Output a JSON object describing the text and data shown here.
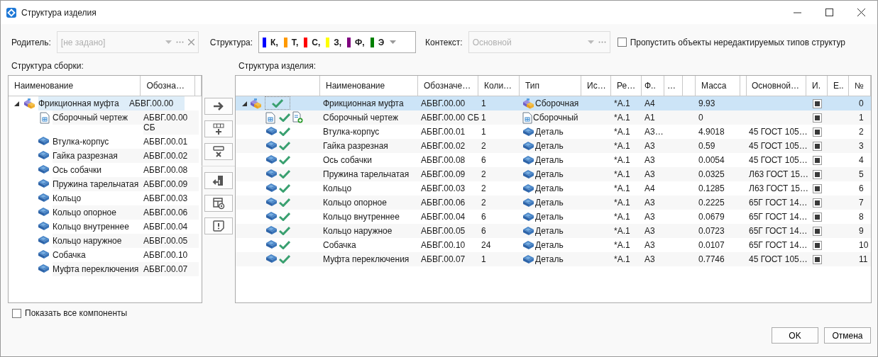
{
  "window": {
    "title": "Структура изделия"
  },
  "parent_field": {
    "label": "Родитель:",
    "placeholder": "[не задано]"
  },
  "structure_field": {
    "label": "Структура:",
    "tags": [
      {
        "text": "К,",
        "color": "#0000ff"
      },
      {
        "text": "Т,",
        "color": "#ff9900"
      },
      {
        "text": "С,",
        "color": "#ff0000"
      },
      {
        "text": "З,",
        "color": "#ffff00"
      },
      {
        "text": "Ф,",
        "color": "#800080"
      },
      {
        "text": "Э",
        "color": "#008000"
      }
    ]
  },
  "context_field": {
    "label": "Контекст:",
    "placeholder": "Основной"
  },
  "skip_checkbox": {
    "label": "Пропустить объекты нередактируемых типов структур",
    "checked": false
  },
  "assembly_tree": {
    "title": "Структура сборки:",
    "columns": [
      "Наименование",
      "Обозна…"
    ],
    "items": [
      {
        "kind": "assembly",
        "name": "Фрикционная муфта",
        "designation": "АБВГ.00.00",
        "selected": true,
        "expanded": true,
        "children": [
          {
            "kind": "drawing",
            "name": "Сборочный чертеж",
            "designation": "АБВГ.00.00 СБ",
            "selected": false
          },
          {
            "kind": "part",
            "name": "Втулка-корпус",
            "designation": "АБВГ.00.01",
            "selected": false
          },
          {
            "kind": "part",
            "name": "Гайка разрезная",
            "designation": "АБВГ.00.02",
            "selected": false
          },
          {
            "kind": "part",
            "name": "Ось собачки",
            "designation": "АБВГ.00.08",
            "selected": false
          },
          {
            "kind": "part",
            "name": "Пружина тарельчатая",
            "designation": "АБВГ.00.09",
            "selected": false
          },
          {
            "kind": "part",
            "name": "Кольцо",
            "designation": "АБВГ.00.03",
            "selected": false
          },
          {
            "kind": "part",
            "name": "Кольцо опорное",
            "designation": "АБВГ.00.06",
            "selected": false
          },
          {
            "kind": "part",
            "name": "Кольцо внутреннее",
            "designation": "АБВГ.00.04",
            "selected": false
          },
          {
            "kind": "part",
            "name": "Кольцо наружное",
            "designation": "АБВГ.00.05",
            "selected": false
          },
          {
            "kind": "part",
            "name": "Собачка",
            "designation": "АБВГ.00.10",
            "selected": false
          },
          {
            "kind": "part",
            "name": "Муфта переключения",
            "designation": "АБВГ.00.07",
            "selected": false
          }
        ]
      }
    ]
  },
  "product_tree": {
    "title": "Структура изделия:",
    "columns": [
      "Наименование",
      "Обозначе…",
      "Коли…",
      "Тип",
      "Ис…",
      "Ре…",
      "Ф..",
      "…",
      "Масса",
      "Основной…",
      "И.",
      "Е..",
      "№"
    ],
    "rows": [
      {
        "kind": "assembly",
        "name": "Фрикционная муфта",
        "designation": "АБВГ.00.00",
        "qty": "1",
        "type": "Сборочная",
        "rev": "*A.1",
        "format": "A4",
        "mass": "9.93",
        "checked": true,
        "number": "0",
        "selected": true,
        "expanded": true,
        "children": [
          {
            "kind": "drawing",
            "name": "Сборочный чертеж",
            "designation": "АБВГ.00.00 СБ",
            "qty": "1",
            "type": "Сборочный",
            "rev": "*A.1",
            "format": "A1",
            "mass": "0",
            "checked": true,
            "number": "1",
            "selected": false
          },
          {
            "kind": "part",
            "name": "Втулка-корпус",
            "designation": "АБВГ.00.01",
            "qty": "1",
            "type": "Деталь",
            "rev": "*A.1",
            "format": "A3…",
            "mass": "4.9018",
            "material": "45 ГОСТ 105…",
            "checked": true,
            "number": "2",
            "selected": false
          },
          {
            "kind": "part",
            "name": "Гайка разрезная",
            "designation": "АБВГ.00.02",
            "qty": "2",
            "type": "Деталь",
            "rev": "*A.1",
            "format": "A3",
            "mass": "0.59",
            "material": "45 ГОСТ 105…",
            "checked": true,
            "number": "3",
            "selected": false
          },
          {
            "kind": "part",
            "name": "Ось собачки",
            "designation": "АБВГ.00.08",
            "qty": "6",
            "type": "Деталь",
            "rev": "*A.1",
            "format": "A3",
            "mass": "0.0054",
            "material": "45 ГОСТ 105…",
            "checked": true,
            "number": "4",
            "selected": false
          },
          {
            "kind": "part",
            "name": "Пружина тарельчатая",
            "designation": "АБВГ.00.09",
            "qty": "2",
            "type": "Деталь",
            "rev": "*A.1",
            "format": "A3",
            "mass": "0.0325",
            "material": "Л63 ГОСТ 15…",
            "checked": true,
            "number": "5",
            "selected": false
          },
          {
            "kind": "part",
            "name": "Кольцо",
            "designation": "АБВГ.00.03",
            "qty": "2",
            "type": "Деталь",
            "rev": "*A.1",
            "format": "A4",
            "mass": "0.1285",
            "material": "Л63 ГОСТ 15…",
            "checked": true,
            "number": "6",
            "selected": false
          },
          {
            "kind": "part",
            "name": "Кольцо опорное",
            "designation": "АБВГ.00.06",
            "qty": "2",
            "type": "Деталь",
            "rev": "*A.1",
            "format": "A3",
            "mass": "0.2225",
            "material": "65Г ГОСТ 14…",
            "checked": true,
            "number": "7",
            "selected": false
          },
          {
            "kind": "part",
            "name": "Кольцо внутреннее",
            "designation": "АБВГ.00.04",
            "qty": "6",
            "type": "Деталь",
            "rev": "*A.1",
            "format": "A3",
            "mass": "0.0679",
            "material": "65Г ГОСТ 14…",
            "checked": true,
            "number": "8",
            "selected": false
          },
          {
            "kind": "part",
            "name": "Кольцо наружное",
            "designation": "АБВГ.00.05",
            "qty": "6",
            "type": "Деталь",
            "rev": "*A.1",
            "format": "A3",
            "mass": "0.0723",
            "material": "65Г ГОСТ 14…",
            "checked": true,
            "number": "9",
            "selected": false
          },
          {
            "kind": "part",
            "name": "Собачка",
            "designation": "АБВГ.00.10",
            "qty": "24",
            "type": "Деталь",
            "rev": "*A.1",
            "format": "A3",
            "mass": "0.0107",
            "material": "65Г ГОСТ 14…",
            "checked": true,
            "number": "10",
            "selected": false
          },
          {
            "kind": "part",
            "name": "Муфта переключения",
            "designation": "АБВГ.00.07",
            "qty": "1",
            "type": "Деталь",
            "rev": "*A.1",
            "format": "A3",
            "mass": "0.7746",
            "material": "45 ГОСТ 105…",
            "checked": true,
            "number": "11",
            "selected": false
          }
        ]
      }
    ]
  },
  "show_all_checkbox": {
    "label": "Показать все компоненты",
    "checked": false
  },
  "buttons": [
    {
      "label": "OK"
    },
    {
      "label": "Отмена"
    }
  ]
}
